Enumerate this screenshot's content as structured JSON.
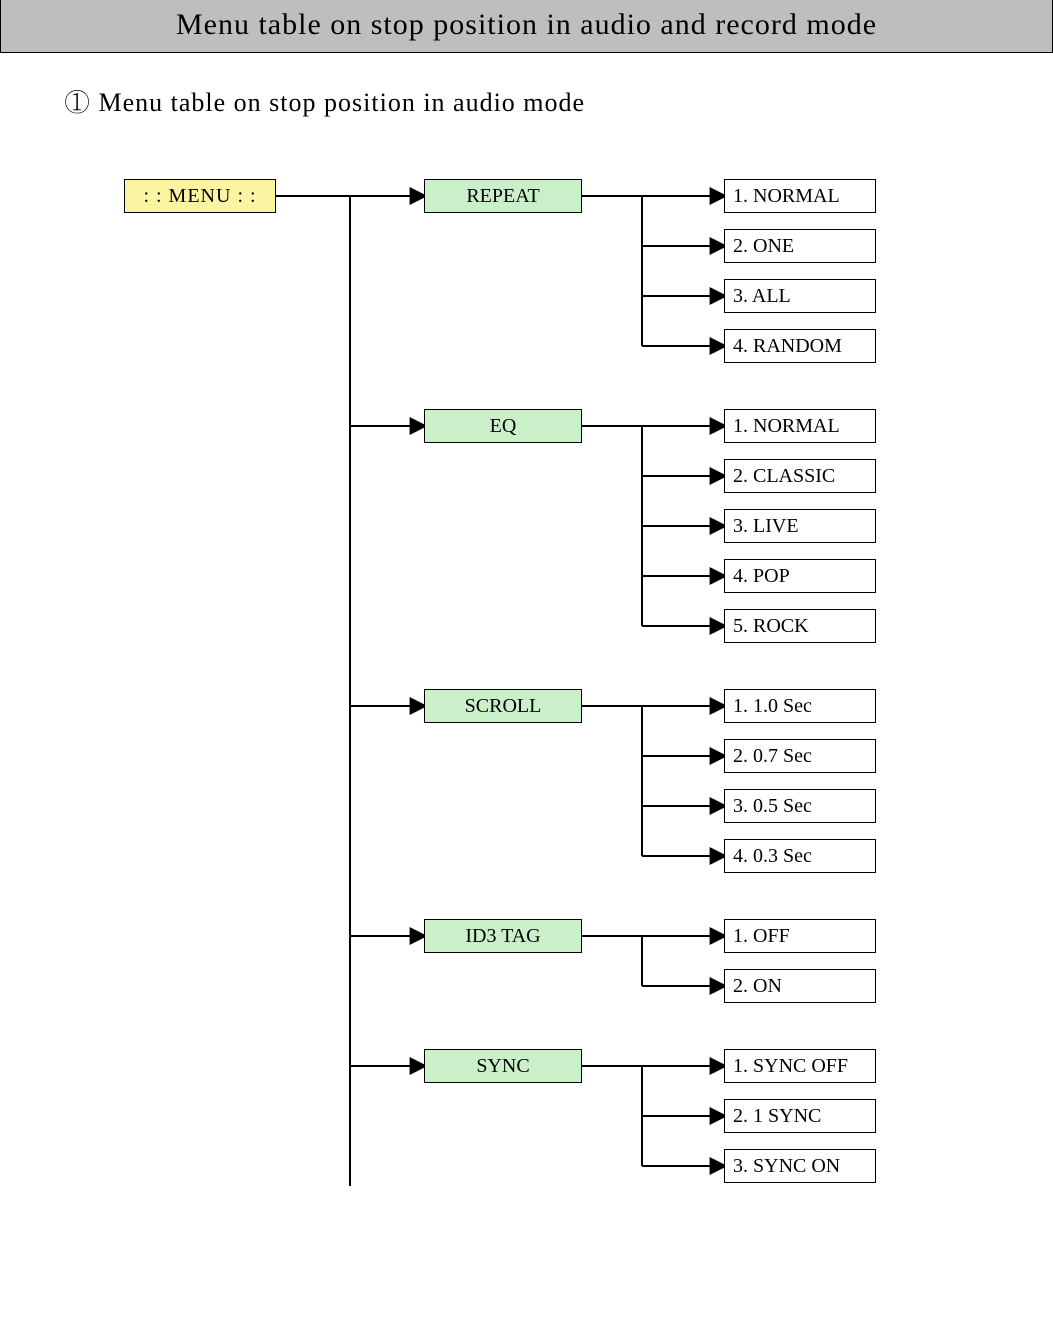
{
  "title": "Menu table on stop position in audio and record mode",
  "subtitle_num": "①",
  "subtitle_text": "Menu table on stop position in audio mode",
  "root": ": : MENU : :",
  "groups": [
    {
      "name": "REPEAT",
      "options": [
        "1. NORMAL",
        "2. ONE",
        "3. ALL",
        "4. RANDOM"
      ]
    },
    {
      "name": "EQ",
      "options": [
        "1. NORMAL",
        "2. CLASSIC",
        "3. LIVE",
        "4. POP",
        "5. ROCK"
      ]
    },
    {
      "name": "SCROLL",
      "options": [
        "1. 1.0 Sec",
        "2. 0.7 Sec",
        "3. 0.5 Sec",
        "4. 0.3 Sec"
      ]
    },
    {
      "name": "ID3 TAG",
      "options": [
        "1. OFF",
        "2. ON"
      ]
    },
    {
      "name": "SYNC",
      "options": [
        "1. SYNC OFF",
        "2. 1 SYNC",
        "3. SYNC ON"
      ]
    }
  ]
}
